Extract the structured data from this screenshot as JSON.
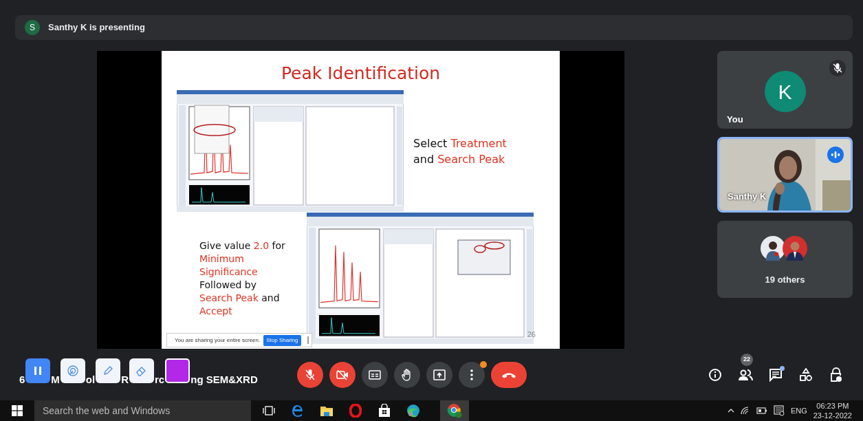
{
  "presenter": {
    "initial": "S",
    "text": "Santhy K is presenting"
  },
  "slide": {
    "title": "Peak Identification",
    "notes": [
      {
        "lines": [
          [
            {
              "text": "Select ",
              "emphasis": false
            },
            {
              "text": "Treatment",
              "emphasis": true
            }
          ],
          [
            {
              "text": "and ",
              "emphasis": false
            },
            {
              "text": "Search Peak",
              "emphasis": true
            }
          ]
        ]
      },
      {
        "lines": [
          [
            {
              "text": "Give value ",
              "emphasis": false
            },
            {
              "text": "2.0",
              "emphasis": true
            },
            {
              "text": " for",
              "emphasis": false
            }
          ],
          [
            {
              "text": "Minimum",
              "emphasis": true
            }
          ],
          [
            {
              "text": "Significance",
              "emphasis": true
            }
          ],
          [
            {
              "text": "Followed by",
              "emphasis": false
            }
          ],
          [
            {
              "text": "Search Peak",
              "emphasis": true
            },
            {
              "text": " and",
              "emphasis": false
            }
          ],
          [
            {
              "text": "Accept",
              "emphasis": true
            }
          ]
        ]
      }
    ],
    "number": "26"
  },
  "share_notice": {
    "text": "You are sharing your entire screen.",
    "button": "Stop Sharing"
  },
  "tiles": [
    {
      "kind": "avatar",
      "initial": "K",
      "name": "You",
      "muted": true,
      "speaking": false,
      "highlighted": false
    },
    {
      "kind": "video",
      "name": "Santhy K",
      "muted": false,
      "speaking": true,
      "highlighted": true
    },
    {
      "kind": "others",
      "label": "19 others"
    }
  ],
  "meeting_title_fragments": [
    "6",
    "M",
    "ol",
    "R",
    "rc",
    "ng SEM&XRD"
  ],
  "annotation_tools": [
    {
      "kind": "pause",
      "active": true
    },
    {
      "kind": "laser",
      "active": false
    },
    {
      "kind": "pen",
      "active": false
    },
    {
      "kind": "eraser",
      "active": false
    },
    {
      "kind": "color",
      "color": "#b228e6"
    }
  ],
  "controls": [
    {
      "kind": "mic",
      "on": false
    },
    {
      "kind": "camera",
      "on": false
    },
    {
      "kind": "captions"
    },
    {
      "kind": "hand"
    },
    {
      "kind": "present"
    },
    {
      "kind": "more",
      "alert": true
    },
    {
      "kind": "end"
    }
  ],
  "side_actions": [
    {
      "kind": "info"
    },
    {
      "kind": "people",
      "badge": "22"
    },
    {
      "kind": "chat",
      "unread": true
    },
    {
      "kind": "activities"
    },
    {
      "kind": "host"
    }
  ],
  "taskbar": {
    "search": {
      "placeholder": "Search the web and Windows"
    },
    "apps": [
      {
        "kind": "taskview",
        "selected": false
      },
      {
        "kind": "edge",
        "selected": false
      },
      {
        "kind": "explorer",
        "selected": false
      },
      {
        "kind": "opera",
        "selected": false
      },
      {
        "kind": "store",
        "selected": false
      },
      {
        "kind": "edge-new",
        "selected": false
      },
      {
        "kind": "chrome",
        "selected": true
      }
    ],
    "language": "ENG",
    "time": "06:23 PM",
    "date": "23-12-2022"
  }
}
